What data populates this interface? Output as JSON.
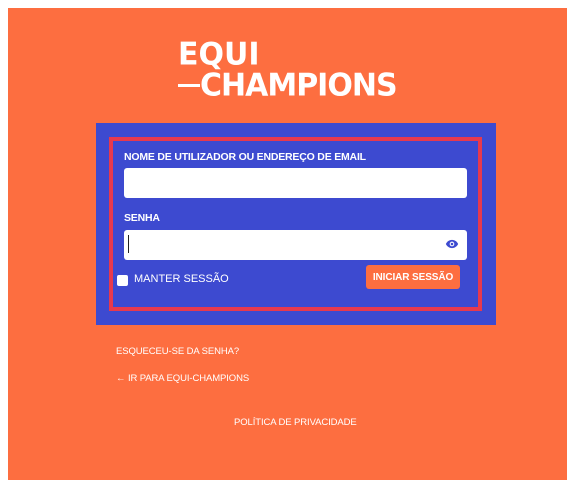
{
  "logo": {
    "line1": "EQUI",
    "line2": "CHAMPIONS"
  },
  "login_form": {
    "username_label": "NOME DE UTILIZADOR OU ENDEREÇO DE EMAIL",
    "username_value": "",
    "password_label": "SENHA",
    "password_value": "",
    "remember_label": "MANTER SESSÃO",
    "remember_checked": false,
    "submit_label": "INICIAR SESSÃO"
  },
  "links": {
    "lost_password": "ESQUECEU-SE DA SENHA?",
    "back_to_site": "← IR PARA EQUI-CHAMPIONS",
    "privacy_policy": "POLÍTICA DE PRIVACIDADE"
  },
  "colors": {
    "page_background": "#fd6e40",
    "panel_background": "#3d4ad0",
    "highlight_border": "#e8394d",
    "eye_icon": "#3d4ad0"
  }
}
